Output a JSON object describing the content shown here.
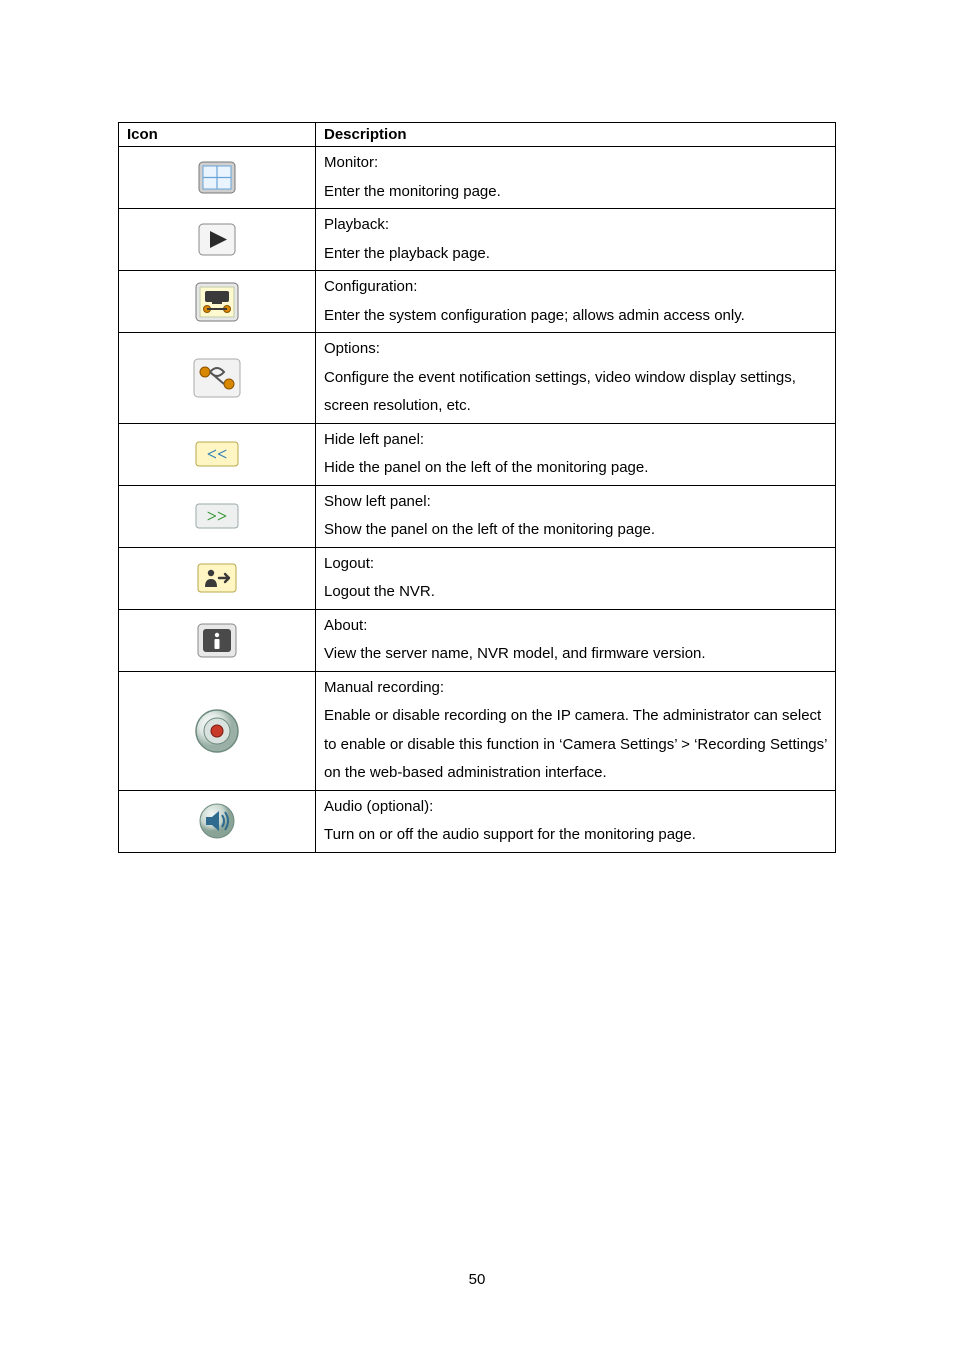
{
  "header": {
    "icon_label": "Icon",
    "desc_label": "Description"
  },
  "rows": [
    {
      "title": "Monitor:",
      "lines": [
        "Enter the monitoring page."
      ]
    },
    {
      "title": "Playback:",
      "lines": [
        "Enter the playback page."
      ]
    },
    {
      "title": "Configuration:",
      "lines": [
        "Enter the system configuration page; allows admin access only."
      ]
    },
    {
      "title": "Options:",
      "lines": [
        "Configure the event notification settings, video window display settings, screen resolution, etc."
      ]
    },
    {
      "title": "Hide left panel:",
      "lines": [
        "Hide the panel on the left of the monitoring page."
      ]
    },
    {
      "title": "Show left panel:",
      "lines": [
        "Show the panel on the left of the monitoring page."
      ]
    },
    {
      "title": "Logout:",
      "lines": [
        "Logout the NVR."
      ]
    },
    {
      "title": "About:",
      "lines": [
        "View the server name, NVR model, and firmware version."
      ]
    },
    {
      "title": "Manual recording:",
      "lines": [
        "Enable or disable recording on the IP camera.   The administrator can select to enable or disable this function in ‘Camera Settings’ > ‘Recording Settings’ on the web-based administration interface."
      ]
    },
    {
      "title": "Audio (optional):",
      "lines": [
        "Turn on or off the audio support for the monitoring page."
      ]
    }
  ],
  "page_number": "50"
}
